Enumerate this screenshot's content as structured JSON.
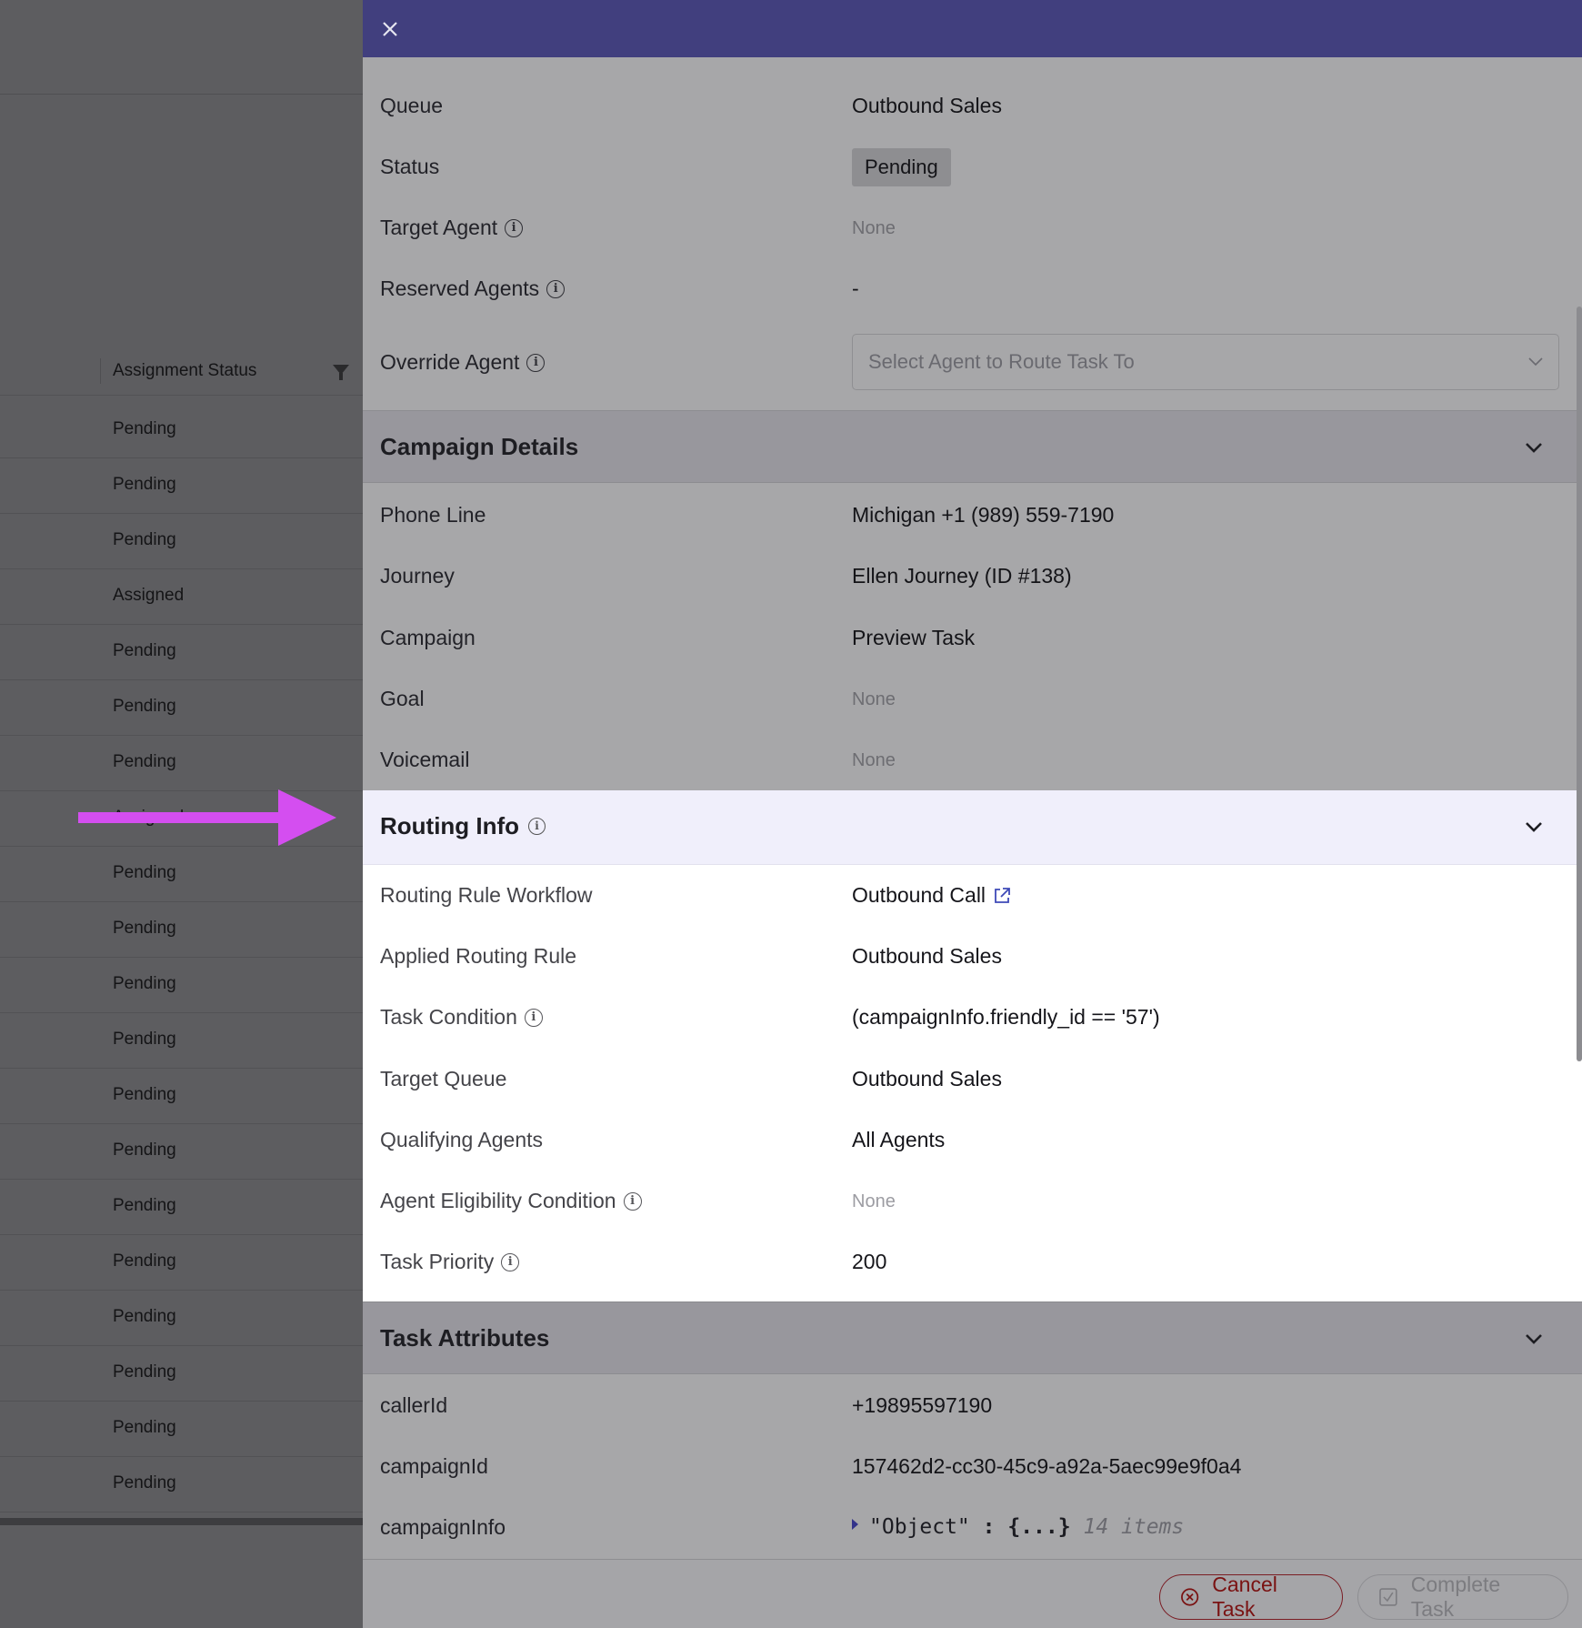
{
  "background_table": {
    "column_header": "Assignment Status",
    "rows": [
      "Pending",
      "Pending",
      "Pending",
      "Assigned",
      "Pending",
      "Pending",
      "Pending",
      "Assigned",
      "Pending",
      "Pending",
      "Pending",
      "Pending",
      "Pending",
      "Pending",
      "Pending",
      "Pending",
      "Pending",
      "Pending",
      "Pending",
      "Pending"
    ]
  },
  "drawer": {
    "close_icon": "close-icon",
    "fields": {
      "queue": {
        "label": "Queue",
        "value": "Outbound Sales"
      },
      "status": {
        "label": "Status",
        "value": "Pending"
      },
      "target_agent": {
        "label": "Target Agent",
        "value": "None"
      },
      "reserved_agents": {
        "label": "Reserved Agents",
        "value": "-"
      },
      "override_agent": {
        "label": "Override Agent",
        "placeholder": "Select Agent to Route Task To"
      }
    },
    "campaign_details": {
      "title": "Campaign Details",
      "phone_line": {
        "label": "Phone Line",
        "value": "Michigan +1 (989) 559-7190"
      },
      "journey": {
        "label": "Journey",
        "value": "Ellen Journey (ID #138)"
      },
      "campaign": {
        "label": "Campaign",
        "value": "Preview Task"
      },
      "goal": {
        "label": "Goal",
        "value": "None"
      },
      "voicemail": {
        "label": "Voicemail",
        "value": "None"
      }
    },
    "routing_info": {
      "title": "Routing Info",
      "workflow": {
        "label": "Routing Rule Workflow",
        "value": "Outbound Call"
      },
      "applied_rule": {
        "label": "Applied Routing Rule",
        "value": "Outbound Sales"
      },
      "task_condition": {
        "label": "Task Condition",
        "value": "(campaignInfo.friendly_id == '57')"
      },
      "target_queue": {
        "label": "Target Queue",
        "value": "Outbound Sales"
      },
      "qualifying_agents": {
        "label": "Qualifying Agents",
        "value": "All Agents"
      },
      "eligibility": {
        "label": "Agent Eligibility Condition",
        "value": "None"
      },
      "priority": {
        "label": "Task Priority",
        "value": "200"
      }
    },
    "task_attributes": {
      "title": "Task Attributes",
      "caller_id": {
        "label": "callerId",
        "value": "+19895597190"
      },
      "campaign_id": {
        "label": "campaignId",
        "value": "157462d2-cc30-45c9-a92a-5aec99e9f0a4"
      },
      "campaign_info": {
        "label": "campaignInfo",
        "key": "\"Object\"",
        "colon": ":",
        "brace": "{...}",
        "count": "14 items"
      }
    },
    "footer": {
      "cancel_label": "Cancel Task",
      "complete_label": "Complete Task"
    }
  },
  "colors": {
    "topbar": "#413f7e",
    "link": "#3e49b7",
    "annotation_arrow": "#d44ef0",
    "cancel": "#7a1212"
  }
}
